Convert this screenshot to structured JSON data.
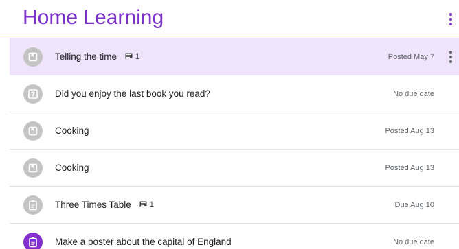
{
  "header": {
    "title": "Home Learning",
    "menu_icon": "more-vert-icon"
  },
  "colors": {
    "accent": "#7b32c9",
    "selected_row": "#efe4fb",
    "avatar_grey": "#c4c4c4",
    "avatar_purple": "#8430ce"
  },
  "items": [
    {
      "title": "Telling the time",
      "comment_count": "1",
      "meta": "Posted May 7",
      "icon": "material-icon",
      "selected": true
    },
    {
      "title": "Did you enjoy the last book you read?",
      "comment_count": "",
      "meta": "No due date",
      "icon": "question-icon",
      "selected": false
    },
    {
      "title": "Cooking",
      "comment_count": "",
      "meta": "Posted Aug 13",
      "icon": "material-icon",
      "selected": false
    },
    {
      "title": "Cooking",
      "comment_count": "",
      "meta": "Posted Aug 13",
      "icon": "material-icon",
      "selected": false
    },
    {
      "title": "Three Times Table",
      "comment_count": "1",
      "meta": "Due Aug 10",
      "icon": "assignment-icon",
      "selected": false
    },
    {
      "title": "Make a poster about the capital of England",
      "comment_count": "",
      "meta": "No due date",
      "icon": "assignment-icon",
      "selected": false
    }
  ]
}
